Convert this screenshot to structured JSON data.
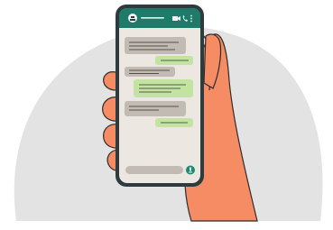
{
  "scene": {
    "subject": "hand-holding-phone-chat",
    "background_circle_color": "#e3e3e3",
    "hand_color": "#f68c64",
    "hand_outline_color": "#2d2d2d",
    "phone_body_color": "#2e3b3e",
    "screen_background_color": "#ece8e1",
    "header_color": "#1f7a6a",
    "incoming_bubble_color": "#c2bbb3",
    "outgoing_bubble_color": "#c3e3a3",
    "fab_color": "#1f8a72"
  },
  "chat": {
    "messages": [
      {
        "direction": "incoming"
      },
      {
        "direction": "outgoing"
      },
      {
        "direction": "incoming"
      },
      {
        "direction": "outgoing"
      },
      {
        "direction": "incoming"
      },
      {
        "direction": "outgoing"
      }
    ]
  }
}
